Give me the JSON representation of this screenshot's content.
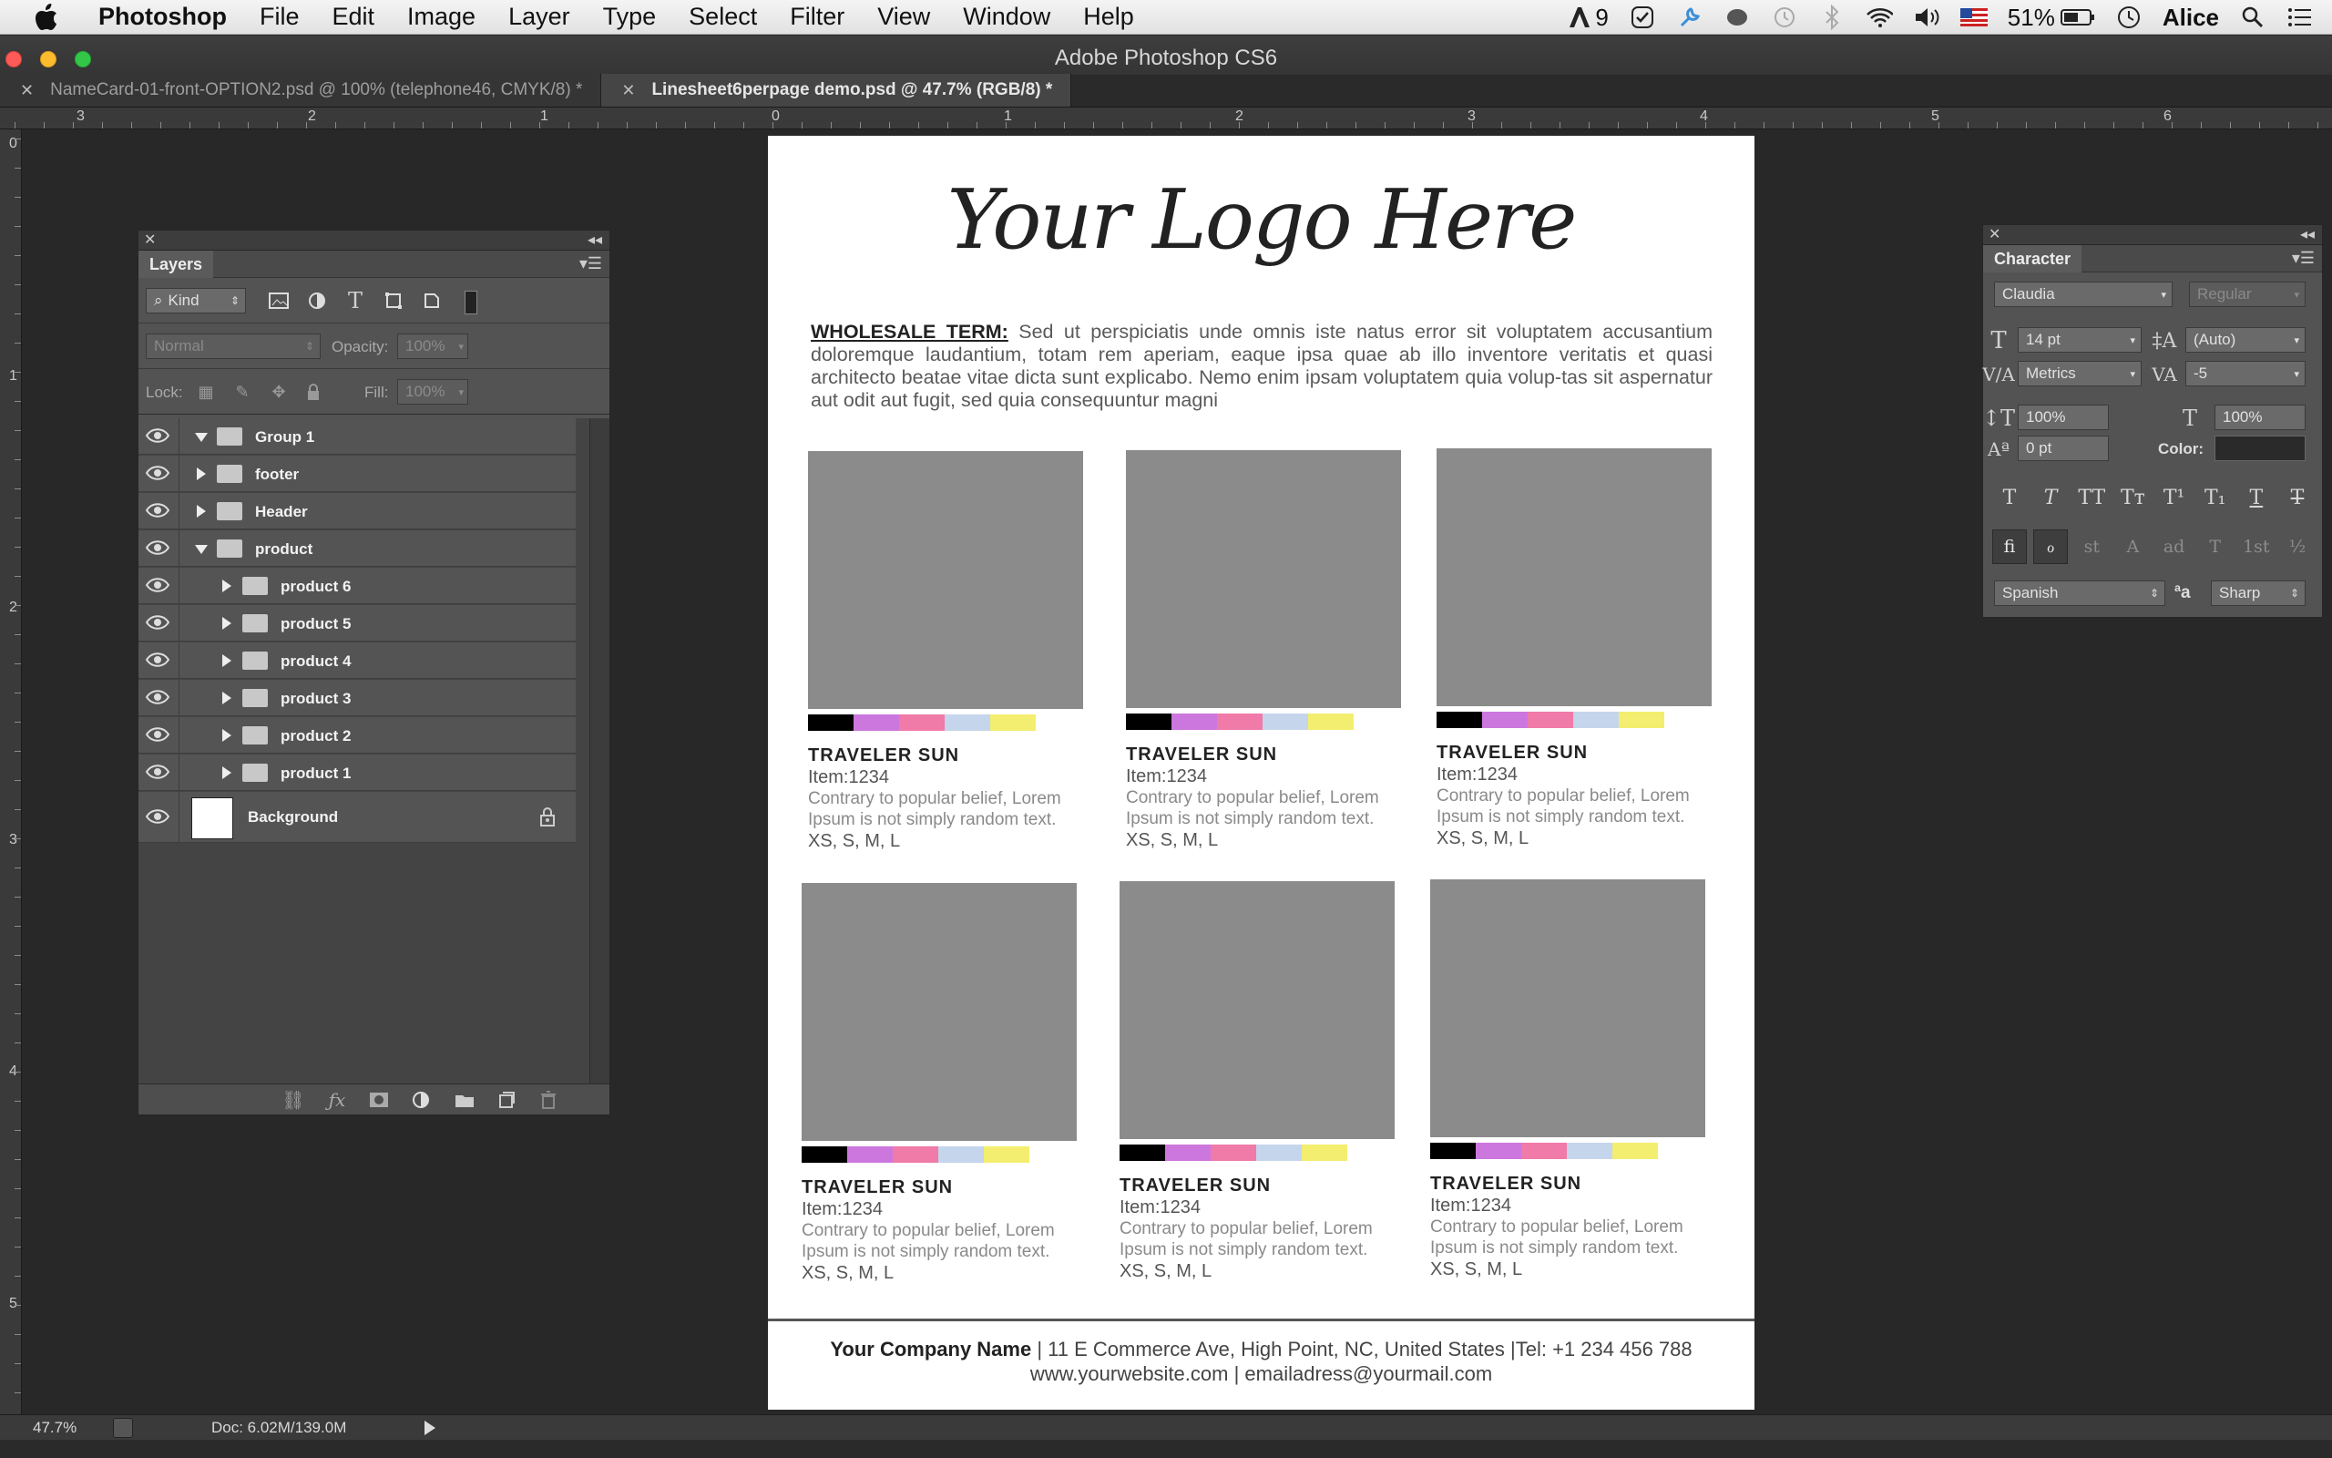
{
  "menubar": {
    "app": "Photoshop",
    "items": [
      "File",
      "Edit",
      "Image",
      "Layer",
      "Type",
      "Select",
      "Filter",
      "View",
      "Window",
      "Help"
    ],
    "status": {
      "notifications": "9",
      "battery": "51%",
      "user": "Alice"
    }
  },
  "window": {
    "title": "Adobe Photoshop CS6"
  },
  "tabs": [
    {
      "label": "NameCard-01-front-OPTION2.psd @ 100% (telephone46, CMYK/8) *",
      "active": false
    },
    {
      "label": "Linesheet6perpage demo.psd @ 47.7% (RGB/8) *",
      "active": true
    }
  ],
  "rulers": {
    "horizontal": [
      "3",
      "2",
      "1",
      "0",
      "1",
      "2",
      "3",
      "4",
      "5",
      "6"
    ],
    "vertical": [
      "0",
      "1",
      "2",
      "3",
      "4",
      "5"
    ]
  },
  "document": {
    "logo": "Your Logo Here",
    "terms_label": "WHOLESALE TERM:",
    "terms_text": " Sed ut perspiciatis unde omnis iste natus error sit voluptatem accusantium doloremque laudantium, totam rem aperiam, eaque ipsa quae ab illo inventore veritatis et quasi architecto beatae vitae dicta sunt explicabo. Nemo enim ipsam voluptatem quia volup-tas sit aspernatur aut odit aut fugit, sed quia consequuntur magni",
    "swatch_colors": [
      "#000000",
      "#cc77dd",
      "#f07aa8",
      "#c5d5ec",
      "#f3ee6f"
    ],
    "products": [
      {
        "name": "TRAVELER SUN",
        "item": "Item:1234",
        "desc": "Contrary to popular belief, Lorem Ipsum is not simply random text.",
        "sizes": "XS, S, M, L"
      },
      {
        "name": "TRAVELER SUN",
        "item": "Item:1234",
        "desc": "Contrary to popular belief, Lorem Ipsum is not simply random text.",
        "sizes": "XS, S, M, L"
      },
      {
        "name": "TRAVELER SUN",
        "item": "Item:1234",
        "desc": "Contrary to popular belief, Lorem Ipsum is not simply random text.",
        "sizes": "XS, S, M, L"
      },
      {
        "name": "TRAVELER SUN",
        "item": "Item:1234",
        "desc": "Contrary to popular belief, Lorem Ipsum is not simply random text.",
        "sizes": "XS, S, M, L"
      },
      {
        "name": "TRAVELER SUN",
        "item": "Item:1234",
        "desc": "Contrary to popular belief, Lorem Ipsum is not simply random text.",
        "sizes": "XS, S, M, L"
      },
      {
        "name": "TRAVELER SUN",
        "item": "Item:1234",
        "desc": "Contrary to popular belief, Lorem Ipsum is not simply random text.",
        "sizes": "XS, S, M, L"
      }
    ],
    "footer": {
      "company": "Your Company Name",
      "address": " |  11 E Commerce Ave, High Point, NC, United States |Tel: +1 234 456 788",
      "contact": "www.yourwebsite.com | emailadress@yourmail.com"
    }
  },
  "layers_panel": {
    "title": "Layers",
    "filter": "Kind",
    "blend_mode": "Normal",
    "opacity_label": "Opacity:",
    "opacity": "100%",
    "lock_label": "Lock:",
    "fill_label": "Fill:",
    "fill": "100%",
    "layers": [
      {
        "name": "Group 1",
        "depth": 0,
        "expanded": true
      },
      {
        "name": "footer",
        "depth": 0,
        "expanded": false
      },
      {
        "name": "Header",
        "depth": 0,
        "expanded": false
      },
      {
        "name": "product",
        "depth": 0,
        "expanded": true
      },
      {
        "name": "product 6",
        "depth": 1,
        "expanded": false
      },
      {
        "name": "product 5",
        "depth": 1,
        "expanded": false
      },
      {
        "name": "product 4",
        "depth": 1,
        "expanded": false
      },
      {
        "name": "product 3",
        "depth": 1,
        "expanded": false
      },
      {
        "name": "product 2",
        "depth": 1,
        "expanded": false
      },
      {
        "name": "product 1",
        "depth": 1,
        "expanded": false
      }
    ],
    "background": "Background"
  },
  "character_panel": {
    "title": "Character",
    "font_family": "Claudia",
    "font_style": "Regular",
    "font_size": "14 pt",
    "leading": "(Auto)",
    "kerning": "Metrics",
    "tracking": "-5",
    "vscale": "100%",
    "hscale": "100%",
    "baseline": "0 pt",
    "color_label": "Color:",
    "styles": [
      "T",
      "T",
      "TT",
      "Tт",
      "T¹",
      "T₁",
      "T",
      "T"
    ],
    "opentype": [
      "fi",
      "ℴ",
      "st",
      "A",
      "ad",
      "T",
      "1st",
      "½"
    ],
    "language": "Spanish",
    "aa_label": "ªa",
    "antialias": "Sharp"
  },
  "status": {
    "zoom": "47.7%",
    "doc": "Doc: 6.02M/139.0M"
  }
}
